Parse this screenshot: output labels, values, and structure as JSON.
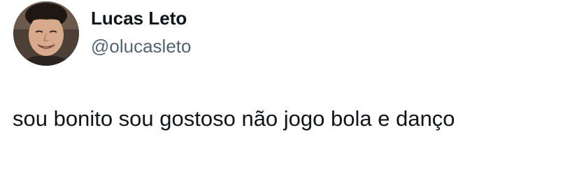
{
  "tweet": {
    "author": {
      "display_name": "Lucas Leto",
      "handle": "@olucasleto"
    },
    "text": "sou bonito sou gostoso não jogo bola e danço"
  },
  "colors": {
    "text_primary": "#0f1419",
    "text_secondary": "#536471",
    "background": "#ffffff"
  }
}
